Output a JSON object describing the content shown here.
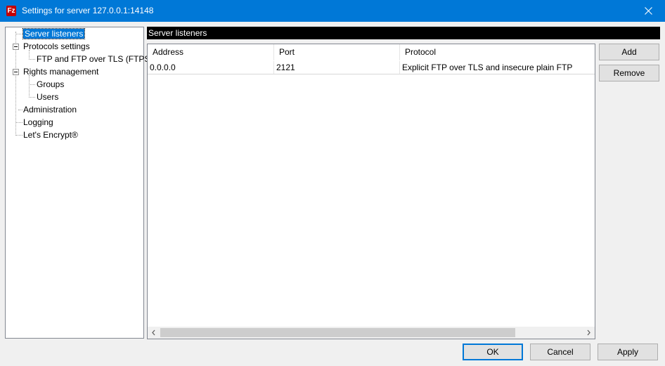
{
  "window": {
    "title": "Settings for server 127.0.0.1:14148",
    "app_icon_letter": "Fz"
  },
  "tree": {
    "items": [
      {
        "label": "Server listeners"
      },
      {
        "label": "Protocols settings"
      },
      {
        "label": "FTP and FTP over TLS (FTPS)"
      },
      {
        "label": "Rights management"
      },
      {
        "label": "Groups"
      },
      {
        "label": "Users"
      },
      {
        "label": "Administration"
      },
      {
        "label": "Logging"
      },
      {
        "label": "Let's Encrypt®"
      }
    ]
  },
  "panel": {
    "title": "Server listeners"
  },
  "listview": {
    "columns": [
      "Address",
      "Port",
      "Protocol"
    ],
    "rows": [
      [
        "0.0.0.0",
        "2121",
        "Explicit FTP over TLS and insecure plain FTP"
      ]
    ]
  },
  "side_buttons": {
    "add": "Add",
    "remove": "Remove"
  },
  "footer": {
    "ok": "OK",
    "cancel": "Cancel",
    "apply": "Apply"
  },
  "colors": {
    "titlebar": "#0078d7",
    "selection": "#0078d7",
    "panel_header": "#000000"
  }
}
